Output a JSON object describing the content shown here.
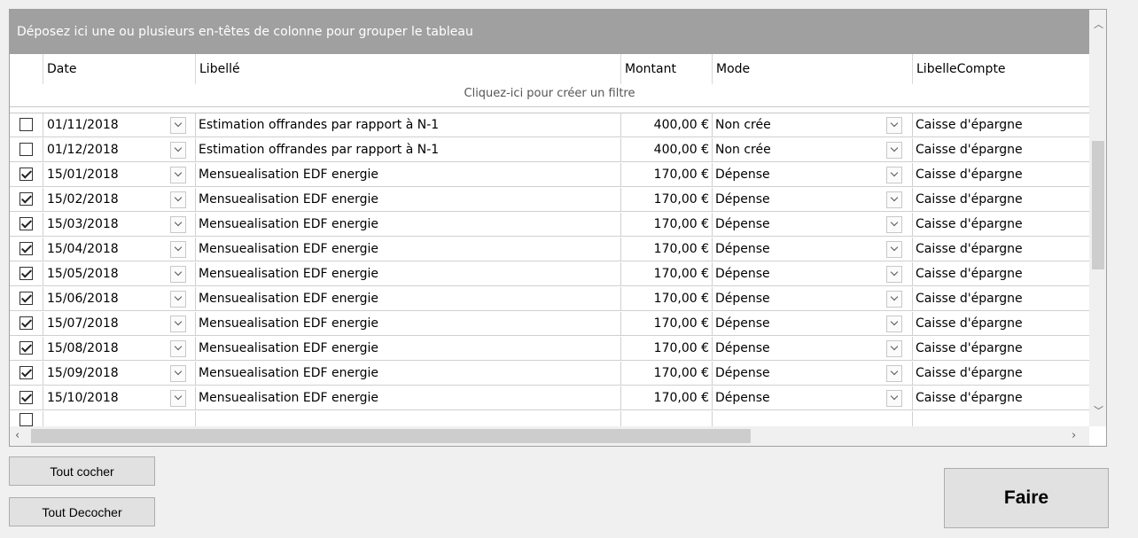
{
  "grid": {
    "group_panel_text": "Déposez ici une ou plusieurs en-têtes de colonne pour grouper le tableau",
    "columns": [
      "Date",
      "Libellé",
      "Montant",
      "Mode",
      "LibelleCompte"
    ],
    "filter_text": "Cliquez-ici pour créer un filtre",
    "rows": [
      {
        "checked": false,
        "date": "01/11/2018",
        "libelle": "Estimation offrandes  par rapport à N-1",
        "montant": "400,00 €",
        "mode": "Non crée",
        "compte": "Caisse d'épargne"
      },
      {
        "checked": false,
        "date": "01/12/2018",
        "libelle": "Estimation offrandes  par rapport à N-1",
        "montant": "400,00 €",
        "mode": "Non crée",
        "compte": "Caisse d'épargne"
      },
      {
        "checked": true,
        "date": "15/01/2018",
        "libelle": "Mensuealisation EDF energie",
        "montant": "170,00 €",
        "mode": "Dépense",
        "compte": "Caisse d'épargne"
      },
      {
        "checked": true,
        "date": "15/02/2018",
        "libelle": "Mensuealisation EDF energie",
        "montant": "170,00 €",
        "mode": "Dépense",
        "compte": "Caisse d'épargne"
      },
      {
        "checked": true,
        "date": "15/03/2018",
        "libelle": "Mensuealisation EDF energie",
        "montant": "170,00 €",
        "mode": "Dépense",
        "compte": "Caisse d'épargne"
      },
      {
        "checked": true,
        "date": "15/04/2018",
        "libelle": "Mensuealisation EDF energie",
        "montant": "170,00 €",
        "mode": "Dépense",
        "compte": "Caisse d'épargne"
      },
      {
        "checked": true,
        "date": "15/05/2018",
        "libelle": "Mensuealisation EDF energie",
        "montant": "170,00 €",
        "mode": "Dépense",
        "compte": "Caisse d'épargne"
      },
      {
        "checked": true,
        "date": "15/06/2018",
        "libelle": "Mensuealisation EDF energie",
        "montant": "170,00 €",
        "mode": "Dépense",
        "compte": "Caisse d'épargne"
      },
      {
        "checked": true,
        "date": "15/07/2018",
        "libelle": "Mensuealisation EDF energie",
        "montant": "170,00 €",
        "mode": "Dépense",
        "compte": "Caisse d'épargne"
      },
      {
        "checked": true,
        "date": "15/08/2018",
        "libelle": "Mensuealisation EDF energie",
        "montant": "170,00 €",
        "mode": "Dépense",
        "compte": "Caisse d'épargne"
      },
      {
        "checked": true,
        "date": "15/09/2018",
        "libelle": "Mensuealisation EDF energie",
        "montant": "170,00 €",
        "mode": "Dépense",
        "compte": "Caisse d'épargne"
      },
      {
        "checked": true,
        "date": "15/10/2018",
        "libelle": "Mensuealisation EDF energie",
        "montant": "170,00 €",
        "mode": "Dépense",
        "compte": "Caisse d'épargne"
      }
    ]
  },
  "buttons": {
    "check_all": "Tout cocher",
    "uncheck_all": "Tout Decocher",
    "do": "Faire"
  },
  "icons": {
    "scroll_up": "chevron-up-icon",
    "scroll_down": "chevron-down-icon",
    "scroll_left": "chevron-left-icon",
    "scroll_right": "chevron-right-icon",
    "dropdown": "chevron-down-icon",
    "checkbox": "checkbox-icon"
  }
}
